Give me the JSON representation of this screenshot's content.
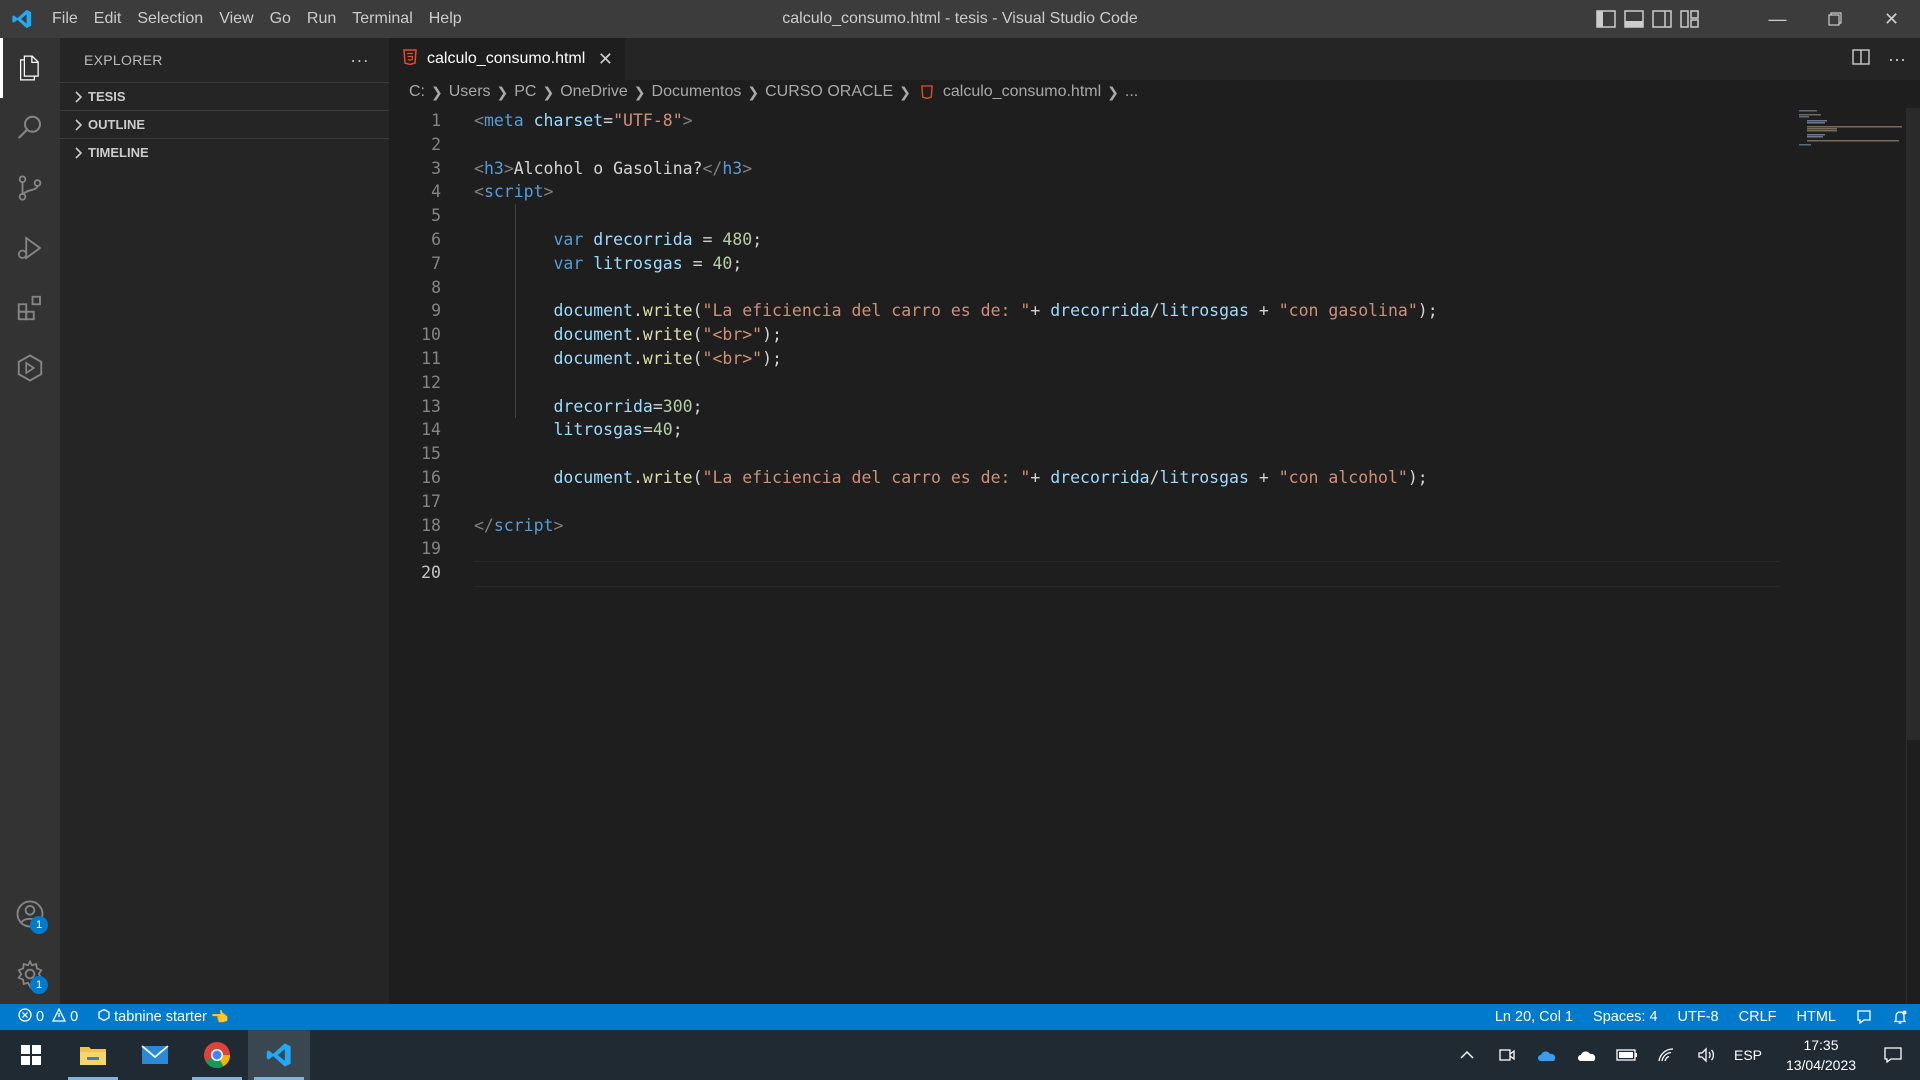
{
  "titlebar": {
    "menu": [
      "File",
      "Edit",
      "Selection",
      "View",
      "Go",
      "Run",
      "Terminal",
      "Help"
    ],
    "title": "calculo_consumo.html - tesis - Visual Studio Code"
  },
  "sidebar": {
    "header": "EXPLORER",
    "more": "···",
    "sections": [
      "TESIS",
      "OUTLINE",
      "TIMELINE"
    ]
  },
  "activitybar": {
    "items": [
      "explorer-icon",
      "search-icon",
      "source-control-icon",
      "run-debug-icon",
      "extensions-icon",
      "remote-explorer-icon"
    ],
    "accounts_badge": "1",
    "settings_badge": "1"
  },
  "editor": {
    "tab": {
      "label": "calculo_consumo.html",
      "close": "✕"
    },
    "breadcrumb": [
      "C:",
      "Users",
      "PC",
      "OneDrive",
      "Documentos",
      "CURSO ORACLE",
      "calculo_consumo.html",
      "..."
    ],
    "lines": [
      {
        "n": "1"
      },
      {
        "n": "2"
      },
      {
        "n": "3"
      },
      {
        "n": "4"
      },
      {
        "n": "5"
      },
      {
        "n": "6"
      },
      {
        "n": "7"
      },
      {
        "n": "8"
      },
      {
        "n": "9"
      },
      {
        "n": "10"
      },
      {
        "n": "11"
      },
      {
        "n": "12"
      },
      {
        "n": "13"
      },
      {
        "n": "14"
      },
      {
        "n": "15"
      },
      {
        "n": "16"
      },
      {
        "n": "17"
      },
      {
        "n": "18"
      },
      {
        "n": "19"
      },
      {
        "n": "20"
      }
    ],
    "code": {
      "l1": {
        "open": "<",
        "tag": "meta",
        "attr": "charset",
        "eq": "=",
        "val": "\"UTF-8\"",
        "close": ">"
      },
      "l3": {
        "open": "<",
        "tag": "h3",
        "close": ">",
        "text": "Alcohol o Gasolina?",
        "eopen": "</",
        "etag": "h3",
        "eclose": ">"
      },
      "l4": {
        "open": "<",
        "tag": "script",
        "close": ">"
      },
      "l6": {
        "kw": "var",
        "var": "drecorrida",
        "op": " = ",
        "num": "480",
        "end": ";"
      },
      "l7": {
        "kw": "var",
        "var": "litrosgas",
        "op": " = ",
        "num": "40",
        "end": ";"
      },
      "l9": {
        "obj": "document",
        "dot": ".",
        "fn": "write",
        "p1": "(",
        "s1": "\"La eficiencia del carro es de: \"",
        "plus1": "+ ",
        "v1": "drecorrida",
        "slash": "/",
        "v2": "litrosgas",
        "plus2": " + ",
        "s2": "\"con gasolina\"",
        "p2": ");"
      },
      "l10": {
        "obj": "document",
        "dot": ".",
        "fn": "write",
        "p1": "(",
        "s1": "\"<br>\"",
        "p2": ");"
      },
      "l11": {
        "obj": "document",
        "dot": ".",
        "fn": "write",
        "p1": "(",
        "s1": "\"<br>\"",
        "p2": ");"
      },
      "l13": {
        "var": "drecorrida",
        "op": "=",
        "num": "300",
        "end": ";"
      },
      "l14": {
        "var": "litrosgas",
        "op": "=",
        "num": "40",
        "end": ";"
      },
      "l16": {
        "obj": "document",
        "dot": ".",
        "fn": "write",
        "p1": "(",
        "s1": "\"La eficiencia del carro es de: \"",
        "plus1": "+ ",
        "v1": "drecorrida",
        "slash": "/",
        "v2": "litrosgas",
        "plus2": " + ",
        "s2": "\"con alcohol\"",
        "p2": ");"
      },
      "l18": {
        "open": "</",
        "tag": "script",
        "close": ">"
      }
    }
  },
  "statusbar": {
    "errors": "0",
    "warnings": "0",
    "tabnine": "tabnine starter",
    "position": "Ln 20, Col 1",
    "spaces": "Spaces: 4",
    "encoding": "UTF-8",
    "eol": "CRLF",
    "language": "HTML"
  },
  "taskbar": {
    "apps": [
      "windows-start-icon",
      "file-explorer-icon",
      "mail-icon",
      "chrome-icon",
      "vscode-icon"
    ],
    "lang": "ESP",
    "time": "17:35",
    "date": "13/04/2023"
  },
  "colors": {
    "accent": "#007acc",
    "editor_bg": "#1e1e1e",
    "sidebar_bg": "#252526",
    "activity_bg": "#333333",
    "titlebar_bg": "#3c3c3c"
  }
}
